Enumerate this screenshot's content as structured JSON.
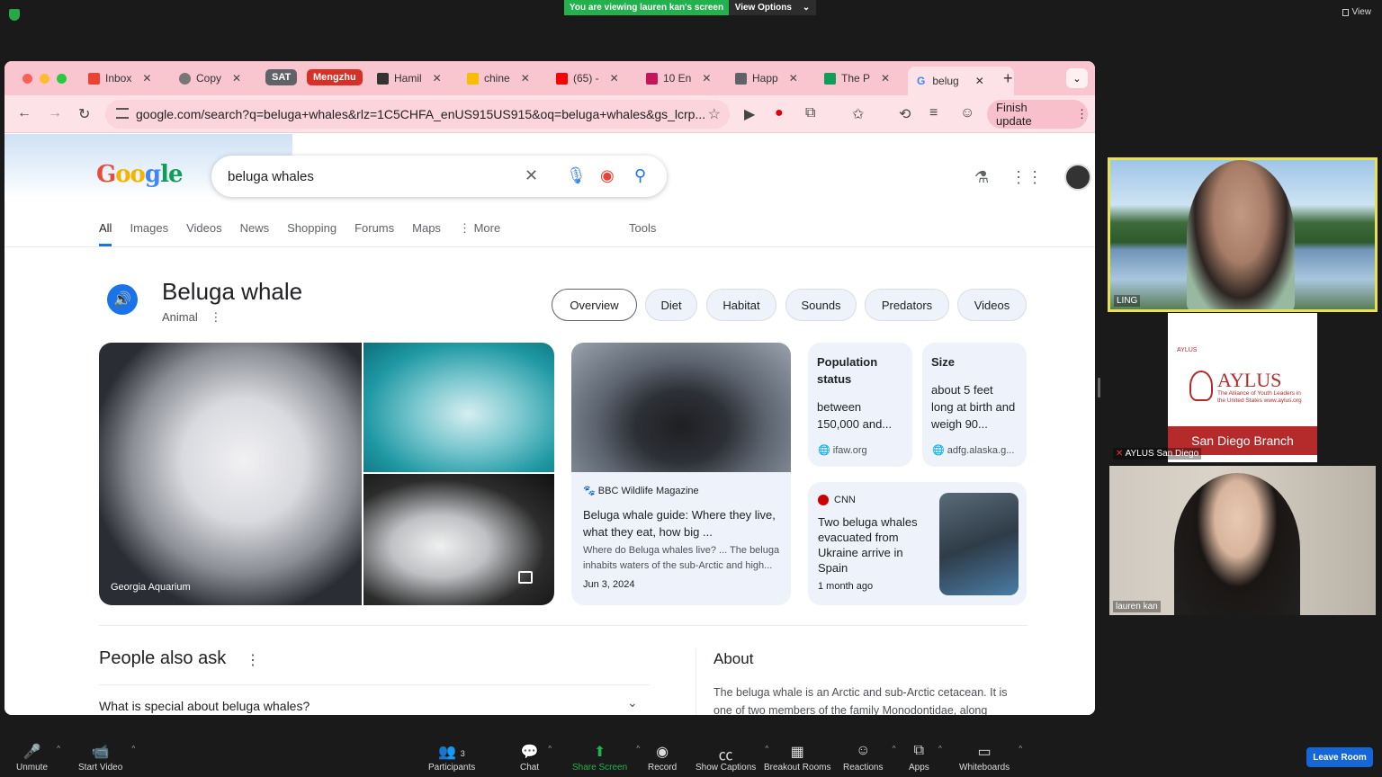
{
  "zoom_banner": {
    "viewing": "You are viewing lauren kan's screen",
    "view_options": "View Options",
    "view": "View"
  },
  "browser": {
    "tabs": [
      {
        "label": "Inbox",
        "color": "#ea4335"
      },
      {
        "label": "Copy",
        "color": "#777777"
      },
      {
        "label": "SAT",
        "pill": true,
        "color": "#5f6368"
      },
      {
        "label": "Mengzhu",
        "pill": true,
        "color": "#d93025"
      },
      {
        "label": "Hamil",
        "color": "#333333"
      },
      {
        "label": "chine",
        "color": "#fbbc04"
      },
      {
        "label": "(65) -",
        "color": "#ff0000"
      },
      {
        "label": "10 En",
        "color": "#c2185b"
      },
      {
        "label": "Happ",
        "color": "#5f6368"
      },
      {
        "label": "The P",
        "color": "#0f9d58"
      }
    ],
    "active_tab": "belug",
    "url": "google.com/search?q=beluga+whales&rlz=1C5CHFA_enUS915US915&oq=beluga+whales&gs_lcrp...",
    "finish_update": "Finish update"
  },
  "google": {
    "query": "beluga whales",
    "nav": [
      "All",
      "Images",
      "Videos",
      "News",
      "Shopping",
      "Forums",
      "Maps",
      "More"
    ],
    "tools": "Tools",
    "kp": {
      "title": "Beluga whale",
      "subtitle": "Animal",
      "chips": [
        "Overview",
        "Diet",
        "Habitat",
        "Sounds",
        "Predators",
        "Videos"
      ],
      "image_caption": "Georgia Aquarium",
      "bbc": {
        "source": "BBC Wildlife Magazine",
        "title": "Beluga whale guide: Where they live, what they eat, how big ...",
        "desc": "Where do Beluga whales live? ... The beluga inhabits waters of the sub-Arctic and high...",
        "date": "Jun 3, 2024"
      },
      "population": {
        "head": "Population status",
        "value": "between 150,000 and...",
        "source": "ifaw.org"
      },
      "size": {
        "head": "Size",
        "value": "about 5 feet long at birth and weigh 90...",
        "source": "adfg.alaska.g..."
      },
      "cnn": {
        "source": "CNN",
        "title": "Two beluga whales evacuated from Ukraine arrive in Spain",
        "date": "1 month ago"
      }
    },
    "paa": {
      "title": "People also ask",
      "q1": "What is special about beluga whales?"
    },
    "about": {
      "title": "About",
      "text": "The beluga whale is an Arctic and sub-Arctic cetacean. It is one of two members of the family Monodontidae, along"
    }
  },
  "participants": [
    {
      "name": "LING"
    },
    {
      "name": "AYLUS San Diego",
      "logo": "AYLUS",
      "logo_small": "AYLUS",
      "tagline": "The Alliance of Youth Leaders in the United States www.aylus.org",
      "branch": "San Diego Branch"
    },
    {
      "name": "lauren kan"
    }
  ],
  "zoom_toolbar": {
    "unmute": "Unmute",
    "start_video": "Start Video",
    "participants": "Participants",
    "participants_count": "3",
    "chat": "Chat",
    "share_screen": "Share Screen",
    "record": "Record",
    "captions": "Show Captions",
    "breakout": "Breakout Rooms",
    "reactions": "Reactions",
    "apps": "Apps",
    "whiteboards": "Whiteboards",
    "leave": "Leave Room"
  },
  "colors": {
    "accent": "#1a73e8",
    "share": "#23b14d",
    "leave": "#1566d8",
    "tabbar": "#f9c5cf"
  }
}
